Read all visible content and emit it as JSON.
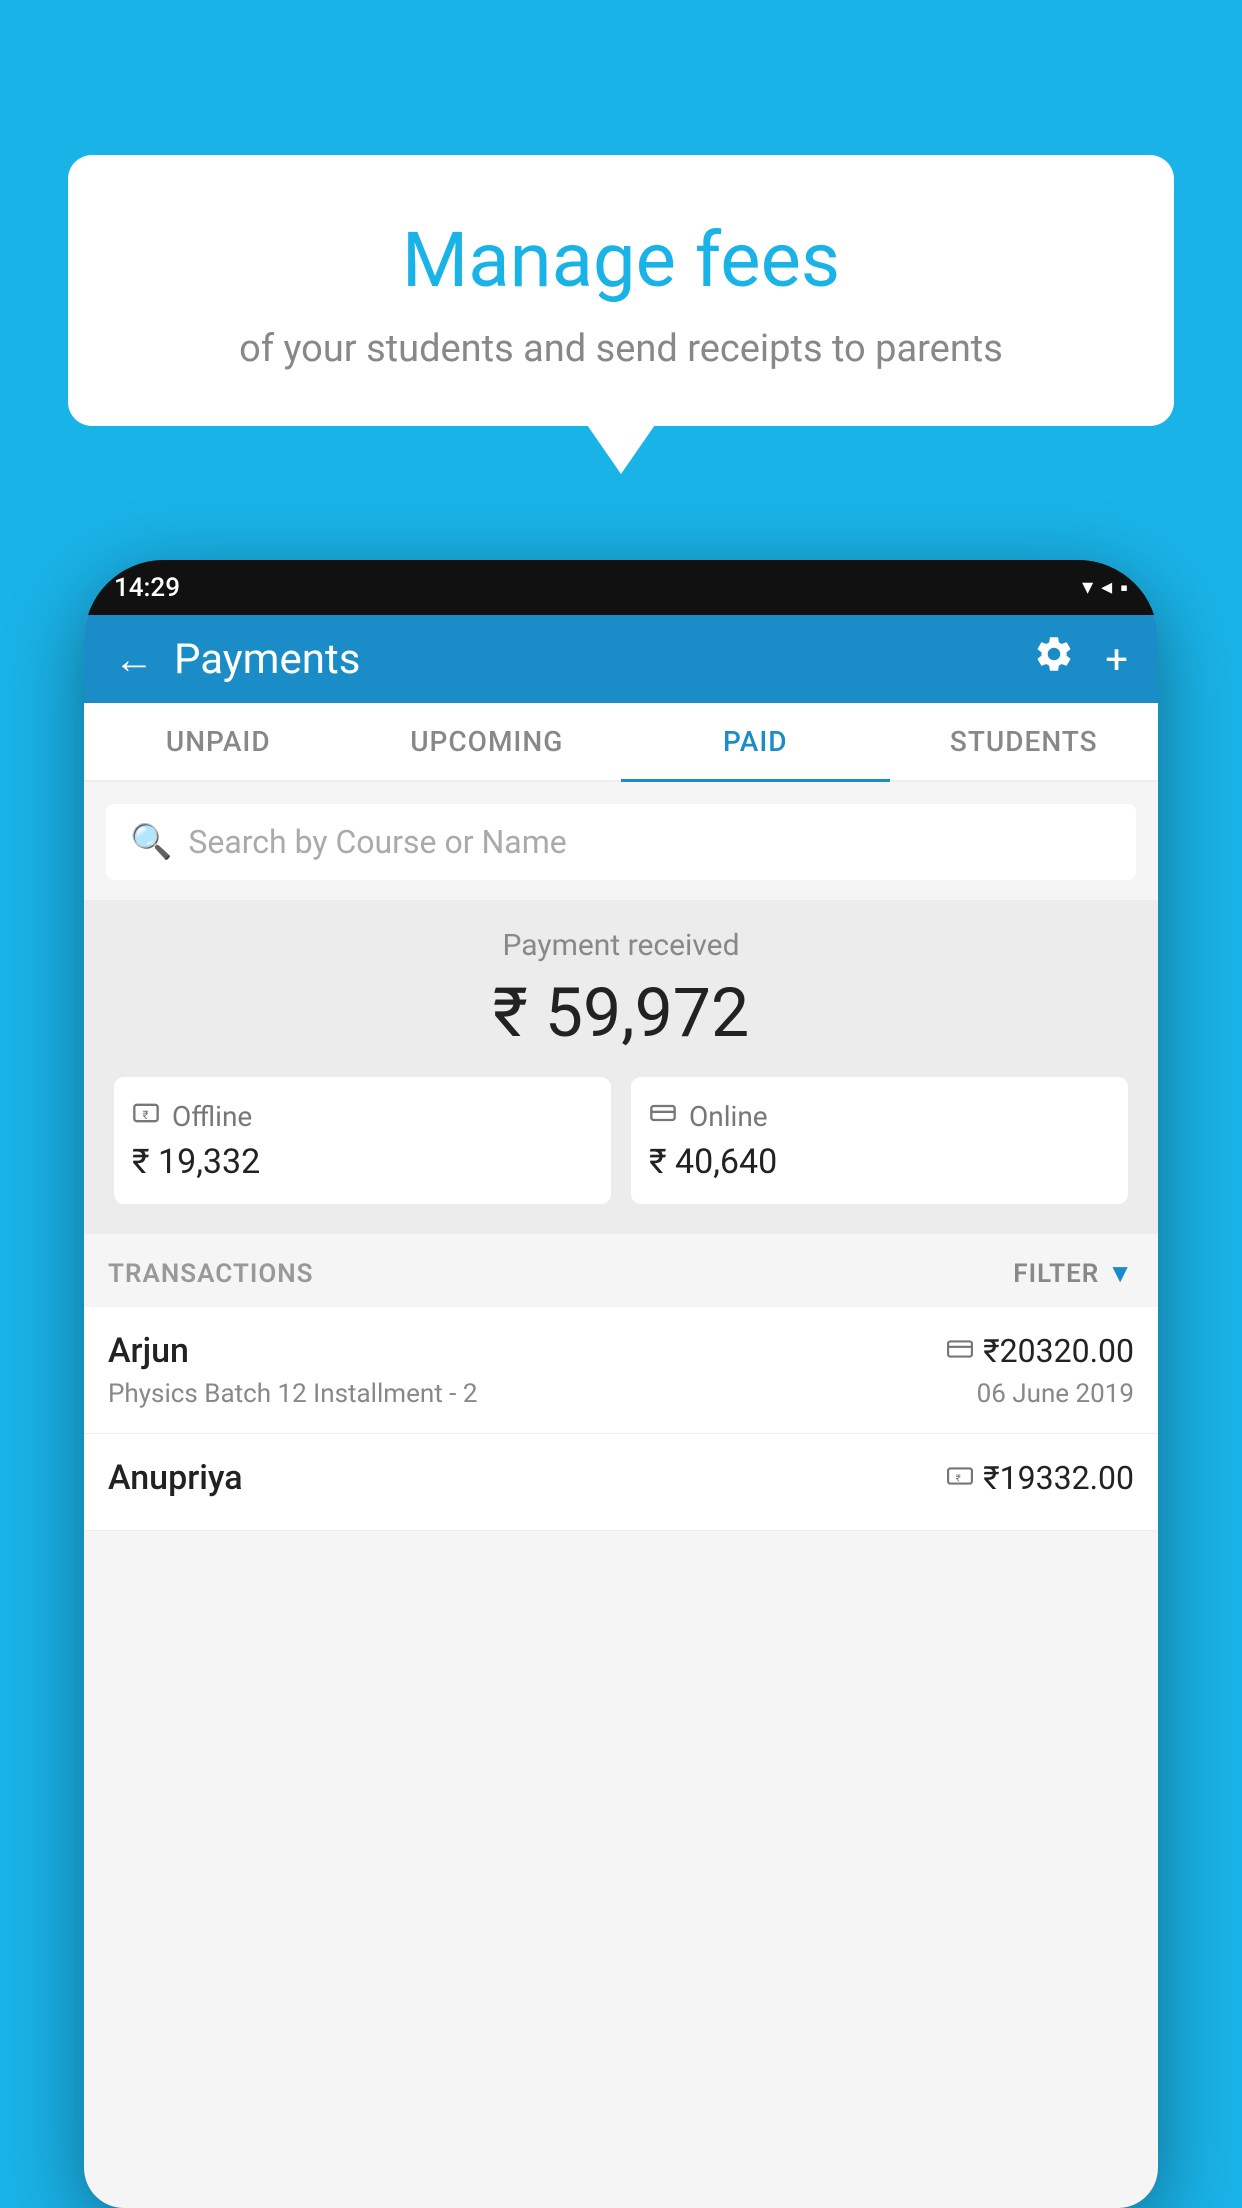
{
  "background_color": "#1ab3e8",
  "speech_bubble": {
    "title": "Manage fees",
    "subtitle": "of your students and send receipts to parents"
  },
  "phone": {
    "time": "14:29",
    "status_icons": "▾◂▪"
  },
  "app": {
    "header": {
      "title": "Payments",
      "back_label": "←",
      "gear_label": "⚙",
      "plus_label": "+"
    },
    "tabs": [
      {
        "label": "UNPAID",
        "active": false
      },
      {
        "label": "UPCOMING",
        "active": false
      },
      {
        "label": "PAID",
        "active": true
      },
      {
        "label": "STUDENTS",
        "active": false
      }
    ],
    "search": {
      "placeholder": "Search by Course or Name"
    },
    "payment_received": {
      "label": "Payment received",
      "amount": "₹ 59,972",
      "offline": {
        "icon": "💳",
        "label": "Offline",
        "amount": "₹ 19,332"
      },
      "online": {
        "icon": "🪪",
        "label": "Online",
        "amount": "₹ 40,640"
      }
    },
    "transactions": {
      "label": "TRANSACTIONS",
      "filter_label": "FILTER",
      "items": [
        {
          "name": "Arjun",
          "course": "Physics Batch 12 Installment - 2",
          "amount": "₹20320.00",
          "date": "06 June 2019",
          "payment_type": "online"
        },
        {
          "name": "Anupriya",
          "course": "",
          "amount": "₹19332.00",
          "date": "",
          "payment_type": "offline"
        }
      ]
    }
  }
}
